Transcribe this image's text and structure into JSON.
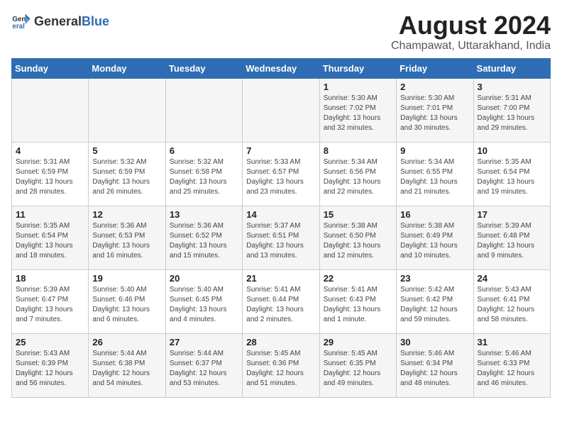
{
  "logo": {
    "general": "General",
    "blue": "Blue"
  },
  "header": {
    "title": "August 2024",
    "subtitle": "Champawat, Uttarakhand, India"
  },
  "days_of_week": [
    "Sunday",
    "Monday",
    "Tuesday",
    "Wednesday",
    "Thursday",
    "Friday",
    "Saturday"
  ],
  "weeks": [
    [
      {
        "day": "",
        "info": ""
      },
      {
        "day": "",
        "info": ""
      },
      {
        "day": "",
        "info": ""
      },
      {
        "day": "",
        "info": ""
      },
      {
        "day": "1",
        "info": "Sunrise: 5:30 AM\nSunset: 7:02 PM\nDaylight: 13 hours\nand 32 minutes."
      },
      {
        "day": "2",
        "info": "Sunrise: 5:30 AM\nSunset: 7:01 PM\nDaylight: 13 hours\nand 30 minutes."
      },
      {
        "day": "3",
        "info": "Sunrise: 5:31 AM\nSunset: 7:00 PM\nDaylight: 13 hours\nand 29 minutes."
      }
    ],
    [
      {
        "day": "4",
        "info": "Sunrise: 5:31 AM\nSunset: 6:59 PM\nDaylight: 13 hours\nand 28 minutes."
      },
      {
        "day": "5",
        "info": "Sunrise: 5:32 AM\nSunset: 6:59 PM\nDaylight: 13 hours\nand 26 minutes."
      },
      {
        "day": "6",
        "info": "Sunrise: 5:32 AM\nSunset: 6:58 PM\nDaylight: 13 hours\nand 25 minutes."
      },
      {
        "day": "7",
        "info": "Sunrise: 5:33 AM\nSunset: 6:57 PM\nDaylight: 13 hours\nand 23 minutes."
      },
      {
        "day": "8",
        "info": "Sunrise: 5:34 AM\nSunset: 6:56 PM\nDaylight: 13 hours\nand 22 minutes."
      },
      {
        "day": "9",
        "info": "Sunrise: 5:34 AM\nSunset: 6:55 PM\nDaylight: 13 hours\nand 21 minutes."
      },
      {
        "day": "10",
        "info": "Sunrise: 5:35 AM\nSunset: 6:54 PM\nDaylight: 13 hours\nand 19 minutes."
      }
    ],
    [
      {
        "day": "11",
        "info": "Sunrise: 5:35 AM\nSunset: 6:54 PM\nDaylight: 13 hours\nand 18 minutes."
      },
      {
        "day": "12",
        "info": "Sunrise: 5:36 AM\nSunset: 6:53 PM\nDaylight: 13 hours\nand 16 minutes."
      },
      {
        "day": "13",
        "info": "Sunrise: 5:36 AM\nSunset: 6:52 PM\nDaylight: 13 hours\nand 15 minutes."
      },
      {
        "day": "14",
        "info": "Sunrise: 5:37 AM\nSunset: 6:51 PM\nDaylight: 13 hours\nand 13 minutes."
      },
      {
        "day": "15",
        "info": "Sunrise: 5:38 AM\nSunset: 6:50 PM\nDaylight: 13 hours\nand 12 minutes."
      },
      {
        "day": "16",
        "info": "Sunrise: 5:38 AM\nSunset: 6:49 PM\nDaylight: 13 hours\nand 10 minutes."
      },
      {
        "day": "17",
        "info": "Sunrise: 5:39 AM\nSunset: 6:48 PM\nDaylight: 13 hours\nand 9 minutes."
      }
    ],
    [
      {
        "day": "18",
        "info": "Sunrise: 5:39 AM\nSunset: 6:47 PM\nDaylight: 13 hours\nand 7 minutes."
      },
      {
        "day": "19",
        "info": "Sunrise: 5:40 AM\nSunset: 6:46 PM\nDaylight: 13 hours\nand 6 minutes."
      },
      {
        "day": "20",
        "info": "Sunrise: 5:40 AM\nSunset: 6:45 PM\nDaylight: 13 hours\nand 4 minutes."
      },
      {
        "day": "21",
        "info": "Sunrise: 5:41 AM\nSunset: 6:44 PM\nDaylight: 13 hours\nand 2 minutes."
      },
      {
        "day": "22",
        "info": "Sunrise: 5:41 AM\nSunset: 6:43 PM\nDaylight: 13 hours\nand 1 minute."
      },
      {
        "day": "23",
        "info": "Sunrise: 5:42 AM\nSunset: 6:42 PM\nDaylight: 12 hours\nand 59 minutes."
      },
      {
        "day": "24",
        "info": "Sunrise: 5:43 AM\nSunset: 6:41 PM\nDaylight: 12 hours\nand 58 minutes."
      }
    ],
    [
      {
        "day": "25",
        "info": "Sunrise: 5:43 AM\nSunset: 6:39 PM\nDaylight: 12 hours\nand 56 minutes."
      },
      {
        "day": "26",
        "info": "Sunrise: 5:44 AM\nSunset: 6:38 PM\nDaylight: 12 hours\nand 54 minutes."
      },
      {
        "day": "27",
        "info": "Sunrise: 5:44 AM\nSunset: 6:37 PM\nDaylight: 12 hours\nand 53 minutes."
      },
      {
        "day": "28",
        "info": "Sunrise: 5:45 AM\nSunset: 6:36 PM\nDaylight: 12 hours\nand 51 minutes."
      },
      {
        "day": "29",
        "info": "Sunrise: 5:45 AM\nSunset: 6:35 PM\nDaylight: 12 hours\nand 49 minutes."
      },
      {
        "day": "30",
        "info": "Sunrise: 5:46 AM\nSunset: 6:34 PM\nDaylight: 12 hours\nand 48 minutes."
      },
      {
        "day": "31",
        "info": "Sunrise: 5:46 AM\nSunset: 6:33 PM\nDaylight: 12 hours\nand 46 minutes."
      }
    ]
  ]
}
